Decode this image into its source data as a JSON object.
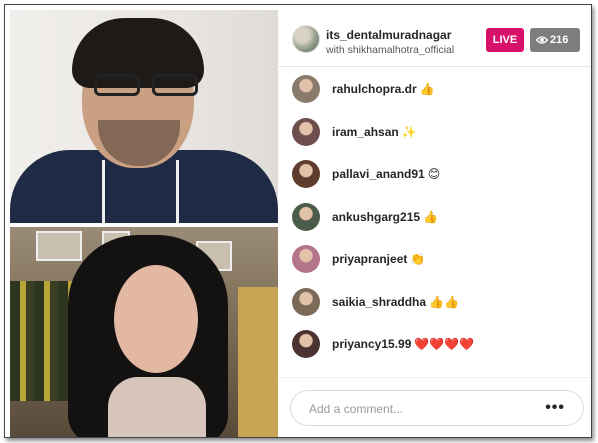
{
  "header": {
    "host_username": "its_dentalmuradnagar",
    "with_text": "with shikhamalhotra_official",
    "live_label": "LIVE",
    "viewer_count": "216",
    "icons": {
      "eye": "eye-icon"
    },
    "colors": {
      "live": "#d8126a",
      "viewers": "#7d7d7d"
    }
  },
  "comments": [
    {
      "username": "rahulchopra.dr",
      "emoji": "👍",
      "avatar_color": "#8a7a6c"
    },
    {
      "username": "iram_ahsan",
      "emoji": "✨",
      "avatar_color": "#6f4e4e"
    },
    {
      "username": "pallavi_anand91",
      "emoji": "😊",
      "avatar_color": "#5e3d2c"
    },
    {
      "username": "ankushgarg215",
      "emoji": "👍",
      "avatar_color": "#4c5c4a"
    },
    {
      "username": "priyapranjeet",
      "emoji": "👏",
      "avatar_color": "#b4748a"
    },
    {
      "username": "saikia_shraddha",
      "emoji": "👍👍",
      "avatar_color": "#7b6a58"
    },
    {
      "username": "priyancy15.99",
      "emoji": "❤️❤️❤️❤️",
      "avatar_color": "#4a3330"
    }
  ],
  "footer": {
    "comment_placeholder": "Add a comment...",
    "more_label": "•••"
  }
}
